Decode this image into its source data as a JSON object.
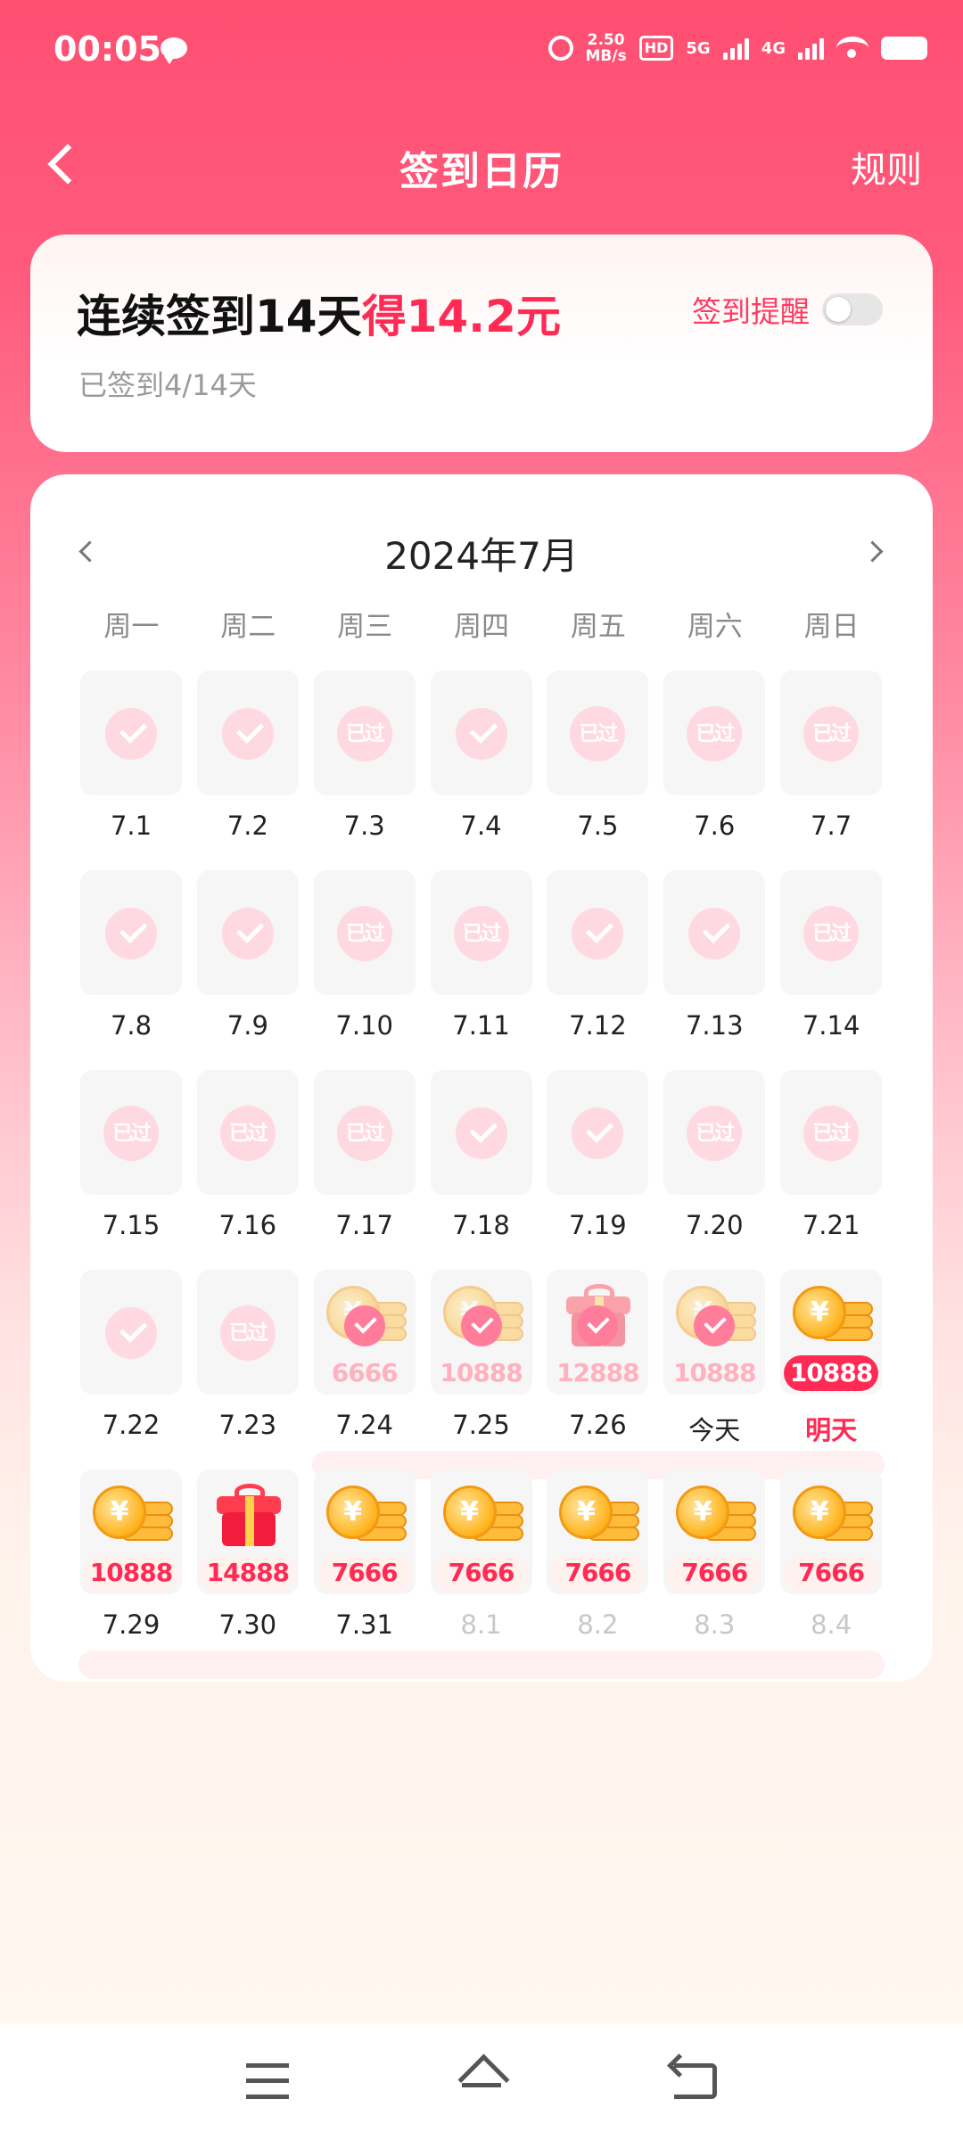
{
  "status_bar": {
    "time": "00:05",
    "speed_top": "2.50",
    "speed_bottom": "MB/s",
    "hd": "HD",
    "net1": "5G",
    "net2": "4G",
    "icons": [
      "message-icon",
      "alarm-icon",
      "hd-icon",
      "signal-icon",
      "wifi-icon",
      "battery-icon"
    ]
  },
  "header": {
    "title": "签到日历",
    "rules": "规则"
  },
  "summary": {
    "title_main": "连续签到14天",
    "title_highlight": "得14.2元",
    "remind_label": "签到提醒",
    "remind_on": false,
    "progress": "已签到4/14天",
    "accent": "#ff2b55"
  },
  "calendar": {
    "month": "2024年7月",
    "weekdays": [
      "周一",
      "周二",
      "周三",
      "周四",
      "周五",
      "周六",
      "周日"
    ],
    "past_label": "已过",
    "weeks": [
      [
        {
          "date": "7.1",
          "state": "checked"
        },
        {
          "date": "7.2",
          "state": "checked"
        },
        {
          "date": "7.3",
          "state": "past"
        },
        {
          "date": "7.4",
          "state": "checked"
        },
        {
          "date": "7.5",
          "state": "past"
        },
        {
          "date": "7.6",
          "state": "past"
        },
        {
          "date": "7.7",
          "state": "past"
        }
      ],
      [
        {
          "date": "7.8",
          "state": "checked"
        },
        {
          "date": "7.9",
          "state": "checked"
        },
        {
          "date": "7.10",
          "state": "past"
        },
        {
          "date": "7.11",
          "state": "past"
        },
        {
          "date": "7.12",
          "state": "checked"
        },
        {
          "date": "7.13",
          "state": "checked"
        },
        {
          "date": "7.14",
          "state": "past"
        }
      ],
      [
        {
          "date": "7.15",
          "state": "past"
        },
        {
          "date": "7.16",
          "state": "past"
        },
        {
          "date": "7.17",
          "state": "past"
        },
        {
          "date": "7.18",
          "state": "checked"
        },
        {
          "date": "7.19",
          "state": "checked"
        },
        {
          "date": "7.20",
          "state": "past"
        },
        {
          "date": "7.21",
          "state": "past"
        }
      ],
      [
        {
          "date": "7.22",
          "state": "checked"
        },
        {
          "date": "7.23",
          "state": "past"
        },
        {
          "date": "7.24",
          "state": "claimed",
          "reward": "6666",
          "icon": "coins"
        },
        {
          "date": "7.25",
          "state": "claimed",
          "reward": "10888",
          "icon": "coins"
        },
        {
          "date": "7.26",
          "state": "claimed",
          "reward": "12888",
          "icon": "gift"
        },
        {
          "date": "今天",
          "state": "claimed",
          "reward": "10888",
          "icon": "coins"
        },
        {
          "date": "明天",
          "state": "tomorrow",
          "reward": "10888",
          "icon": "coins"
        }
      ],
      [
        {
          "date": "7.29",
          "state": "reward",
          "reward": "10888",
          "icon": "coins"
        },
        {
          "date": "7.30",
          "state": "reward",
          "reward": "14888",
          "icon": "gift"
        },
        {
          "date": "7.31",
          "state": "reward",
          "reward": "7666",
          "icon": "coins"
        },
        {
          "date": "8.1",
          "state": "reward",
          "reward": "7666",
          "icon": "coins",
          "muted": true
        },
        {
          "date": "8.2",
          "state": "reward",
          "reward": "7666",
          "icon": "coins",
          "muted": true
        },
        {
          "date": "8.3",
          "state": "reward",
          "reward": "7666",
          "icon": "coins",
          "muted": true
        },
        {
          "date": "8.4",
          "state": "reward",
          "reward": "7666",
          "icon": "coins",
          "muted": true
        }
      ]
    ]
  },
  "nav_bar": {
    "icons": [
      "menu-icon",
      "home-icon",
      "back-icon"
    ]
  }
}
